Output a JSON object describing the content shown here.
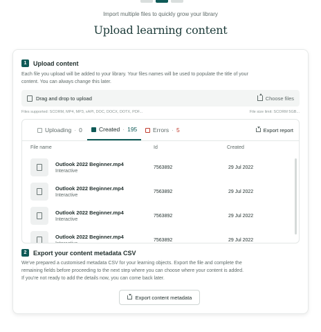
{
  "header": {
    "subtitle": "Import multiple files to quickly grow your library",
    "title": "Upload learning content"
  },
  "upload_section": {
    "number": "1",
    "title": "Upload content",
    "description_line1": "Each file you upload will be added to your library. Your files names will be used to populate the title of your",
    "description_line2": "content. You can always change this later.",
    "dropzone_label": "Drag and drop to upload",
    "choose_files_label": "Choose files",
    "files_supported": "Files supported: SCORM, MP4, MP3, xAPI, DOC, DOCX, DOTX, PDF...",
    "file_size_limit": "File size limit: SCORM 5GB..."
  },
  "tabs": [
    {
      "label": "Uploading",
      "count": "0"
    },
    {
      "label": "Created",
      "count": "195"
    },
    {
      "label": "Errors",
      "count": "5"
    }
  ],
  "tab_separator": "·",
  "export_report_label": "Export report",
  "table": {
    "columns": [
      "File name",
      "Id",
      "Created"
    ],
    "rows": [
      {
        "name": "Outlook 2022 Beginner.mp4",
        "type": "Interactive",
        "id": "7563892",
        "created": "29 Jul 2022"
      },
      {
        "name": "Outlook 2022 Beginner.mp4",
        "type": "Interactive",
        "id": "7563892",
        "created": "29 Jul 2022"
      },
      {
        "name": "Outlook 2022 Beginner.mp4",
        "type": "Interactive",
        "id": "7563892",
        "created": "29 Jul 2022"
      },
      {
        "name": "Outlook 2022 Beginner.mp4",
        "type": "Interactive",
        "id": "7563892",
        "created": "29 Jul 2022"
      }
    ]
  },
  "export_section": {
    "number": "2",
    "title": "Export your content metadata CSV",
    "description_line1": "We've prepared a customised metadata CSV for your learning objects. Export the file and complete the",
    "description_line2": "remaining fields before proceeding to the next step where you can choose where your content is added.",
    "description_line3": "If you're not ready to add the details now, you can come back later.",
    "button_label": "Export content metadata"
  },
  "colors": {
    "accent": "#0f5a57",
    "error": "#c0392b"
  },
  "icons": {
    "dropzone": "file-icon",
    "choose_files": "upload-icon",
    "export_report": "download-icon",
    "export_button": "download-icon",
    "row_thumb": "document-icon"
  }
}
